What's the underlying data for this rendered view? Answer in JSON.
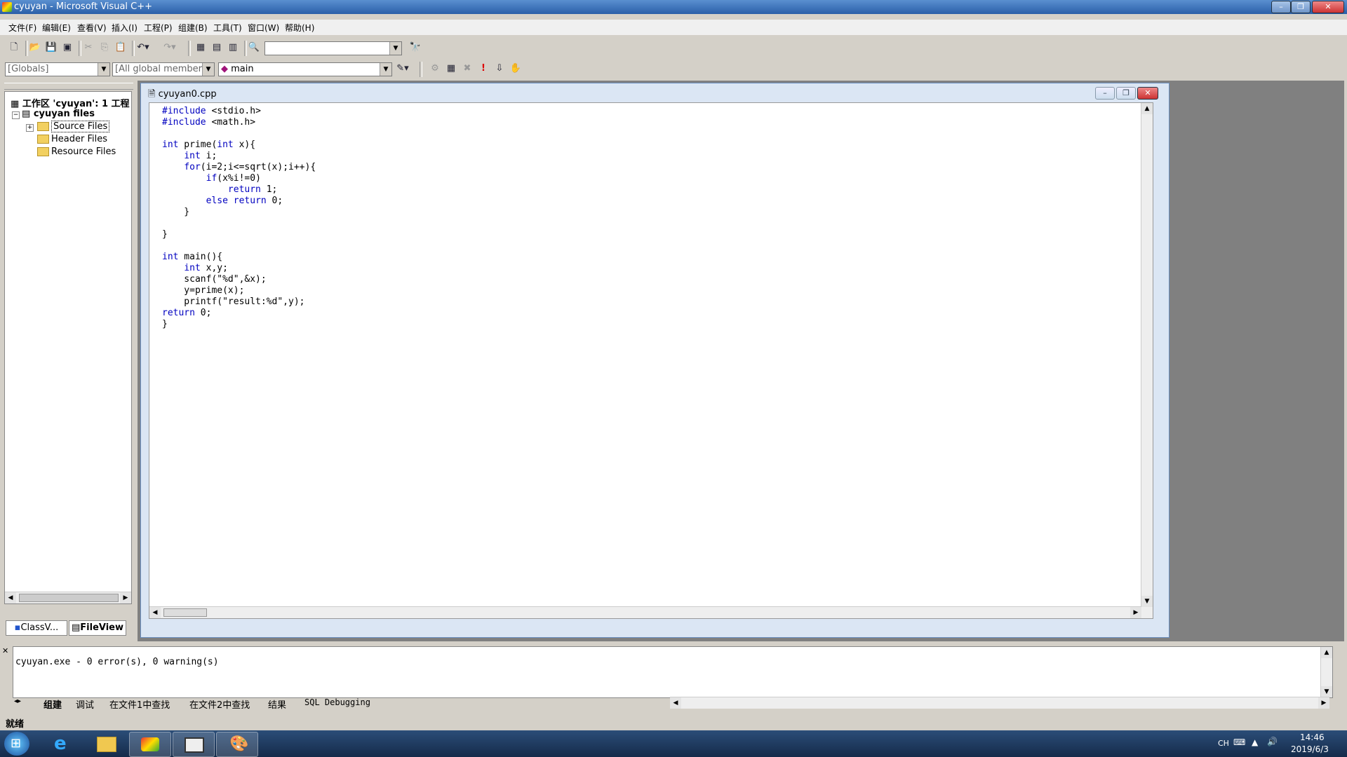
{
  "window": {
    "title": "cyuyan - Microsoft Visual C++"
  },
  "menu": [
    "文件(F)",
    "编辑(E)",
    "查看(V)",
    "插入(I)",
    "工程(P)",
    "组建(B)",
    "工具(T)",
    "窗口(W)",
    "帮助(H)"
  ],
  "wizard_bar": {
    "scope": "[Globals]",
    "filter": "[All global members",
    "member": "main"
  },
  "workspace": {
    "root": "工作区 'cyuyan': 1 工程",
    "project": "cyuyan files",
    "folders": [
      "Source Files",
      "Header Files",
      "Resource Files"
    ],
    "tabs": [
      "ClassV...",
      "FileView"
    ]
  },
  "editor": {
    "filename": "cyuyan0.cpp",
    "lines": [
      "#include <stdio.h>",
      "#include <math.h>",
      "",
      "int prime(int x){",
      "    int i;",
      "    for(i=2;i<=sqrt(x);i++){",
      "        if(x%i!=0)",
      "            return 1;",
      "        else return 0;",
      "    }",
      "",
      "}",
      "",
      "int main(){",
      "    int x,y;",
      "    scanf(\"%d\",&x);",
      "    y=prime(x);",
      "    printf(\"result:%d\",y);",
      "return 0;",
      "}"
    ]
  },
  "output": {
    "text": "cyuyan.exe - 0 error(s), 0 warning(s)",
    "tabs": [
      "组建",
      "调试",
      "在文件1中查找",
      "在文件2中查找",
      "结果",
      "SQL Debugging"
    ]
  },
  "status": "就绪",
  "taskbar": {
    "lang": "CH",
    "time": "14:46",
    "date": "2019/6/3"
  },
  "colors": {
    "keyword": "#0000c0",
    "titlebar": "#2a5fa8",
    "taskbar": "#152b4a"
  }
}
